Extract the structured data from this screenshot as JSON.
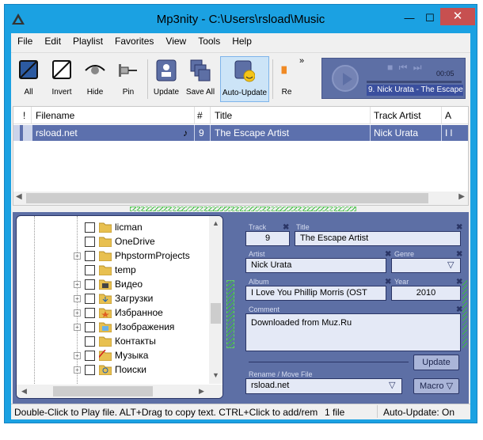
{
  "window": {
    "title": "Mp3nity - C:\\Users\\rsload\\Music",
    "minimize": "—",
    "maximize": "☐",
    "close": "✕"
  },
  "menu": [
    "File",
    "Edit",
    "Playlist",
    "Favorites",
    "View",
    "Tools",
    "Help"
  ],
  "toolbar": {
    "buttons": [
      {
        "label": "All",
        "icon": "select-all-icon"
      },
      {
        "label": "Invert",
        "icon": "invert-selection-icon"
      },
      {
        "label": "Hide",
        "icon": "hide-eye-icon"
      },
      {
        "label": "Pin",
        "icon": "pin-icon"
      },
      {
        "label": "Update",
        "icon": "update-icon"
      },
      {
        "label": "Save All",
        "icon": "save-all-icon"
      },
      {
        "label": "Auto-Update",
        "icon": "auto-update-icon"
      },
      {
        "label": "Re",
        "icon": "refresh-icon"
      }
    ],
    "overflow": "»"
  },
  "player": {
    "time": "00:05",
    "track": "9. Nick Urata - The Escape Artist"
  },
  "grid": {
    "columns": [
      "!",
      "Filename",
      "#",
      "Title",
      "Track Artist",
      "A"
    ],
    "rows": [
      {
        "flag": "",
        "filename": "rsload.net",
        "note": "♪",
        "num": "9",
        "title": "The Escape Artist",
        "artist": "Nick Urata",
        "album": "I l"
      }
    ]
  },
  "tree": {
    "items": [
      {
        "label": "licman",
        "expandable": false
      },
      {
        "label": "OneDrive",
        "expandable": false
      },
      {
        "label": "PhpstormProjects",
        "expandable": true
      },
      {
        "label": "temp",
        "expandable": false
      },
      {
        "label": "Видео",
        "expandable": true
      },
      {
        "label": "Загрузки",
        "expandable": true
      },
      {
        "label": "Избранное",
        "expandable": true
      },
      {
        "label": "Изображения",
        "expandable": true
      },
      {
        "label": "Контакты",
        "expandable": false
      },
      {
        "label": "Музыка",
        "expandable": true
      },
      {
        "label": "Поиски",
        "expandable": true
      }
    ]
  },
  "tags": {
    "track_label": "Track",
    "track": "9",
    "title_label": "Title",
    "title": "The Escape Artist",
    "artist_label": "Artist",
    "artist": "Nick Urata",
    "genre_label": "Genre",
    "genre": "",
    "album_label": "Album",
    "album": "I Love You Phillip Morris (OST",
    "year_label": "Year",
    "year": "2010",
    "comment_label": "Comment",
    "comment": "Downloaded from Muz.Ru",
    "update_button": "Update",
    "rename_label": "Rename / Move File",
    "rename_value": "rsload.net",
    "macro_button": "Macro ▽"
  },
  "status": {
    "hint": "Double-Click to Play file. ALT+Drag to copy text. CTRL+Click to add/rem",
    "count": "1 file",
    "autoupdate": "Auto-Update: On"
  },
  "colors": {
    "titlebar": "#1ba1e2",
    "panel": "#5d6fa5",
    "selection": "#cbd3ea"
  }
}
